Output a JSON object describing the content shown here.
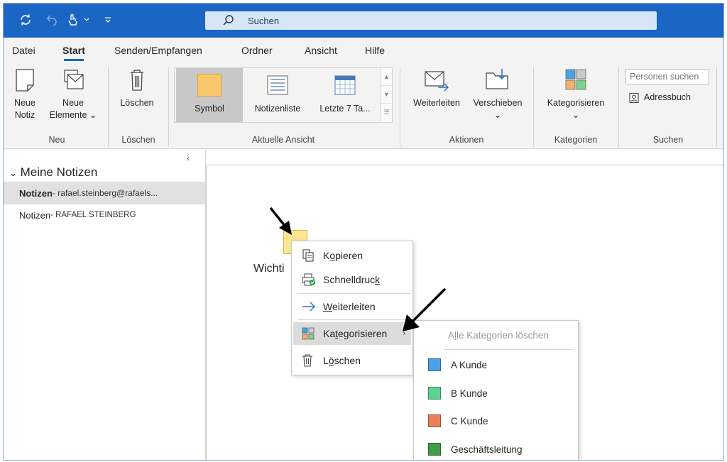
{
  "colors": {
    "titlebar": "#1b65c4",
    "accent": "#1b65c4"
  },
  "titlebar": {
    "search_text": "Suchen"
  },
  "tabs": [
    {
      "label": "Datei"
    },
    {
      "label": "Start"
    },
    {
      "label": "Senden/Empfangen"
    },
    {
      "label": "Ordner"
    },
    {
      "label": "Ansicht"
    },
    {
      "label": "Hilfe"
    }
  ],
  "ribbon": {
    "neu": {
      "note_line1": "Neue",
      "note_line2": "Notiz",
      "items_line1": "Neue",
      "items_line2": "Elemente",
      "group": "Neu"
    },
    "loeschen": {
      "button": "Löschen",
      "group": "Löschen"
    },
    "ansicht": {
      "symbol": "Symbol",
      "notizenliste": "Notizenliste",
      "letzte": "Letzte 7 Ta...",
      "group": "Aktuelle Ansicht"
    },
    "aktionen": {
      "weiterleiten": "Weiterleiten",
      "verschieben": "Verschieben",
      "group": "Aktionen"
    },
    "kategorien": {
      "kategorisieren": "Kategorisieren",
      "group": "Kategorien"
    },
    "suchen": {
      "people_placeholder": "Personen suchen",
      "adressbuch": "Adressbuch",
      "group": "Suchen"
    }
  },
  "sidebar": {
    "root": "Meine Notizen",
    "items": [
      {
        "name": "Notizen",
        "account": " - rafael.steinberg@rafaels..."
      },
      {
        "name": "Notizen",
        "account": " - RAFAEL STEINBERG"
      }
    ]
  },
  "note": {
    "title": "Wichti"
  },
  "context_menu": {
    "kopieren": {
      "pre": "K",
      "ul": "o",
      "post": "pieren"
    },
    "schnelldruck": {
      "pre": "Schnelldruc",
      "ul": "k",
      "post": ""
    },
    "weiterleiten": {
      "pre": "",
      "ul": "W",
      "post": "eiterleiten"
    },
    "kategorisieren": {
      "pre": "Ka",
      "ul": "t",
      "post": "egorisieren"
    },
    "loeschen": {
      "pre": "L",
      "ul": "ö",
      "post": "schen"
    }
  },
  "submenu": {
    "clear": {
      "pre": "A",
      "ul": "l",
      "post": "le Kategorien löschen"
    },
    "categories": [
      {
        "label": "A Kunde",
        "color": "#4aa3e6"
      },
      {
        "label": "B Kunde",
        "color": "#5cd390"
      },
      {
        "label": "C Kunde",
        "color": "#ec8055"
      },
      {
        "label": "Geschäftsleitung",
        "color": "#3f9e4a"
      }
    ]
  }
}
